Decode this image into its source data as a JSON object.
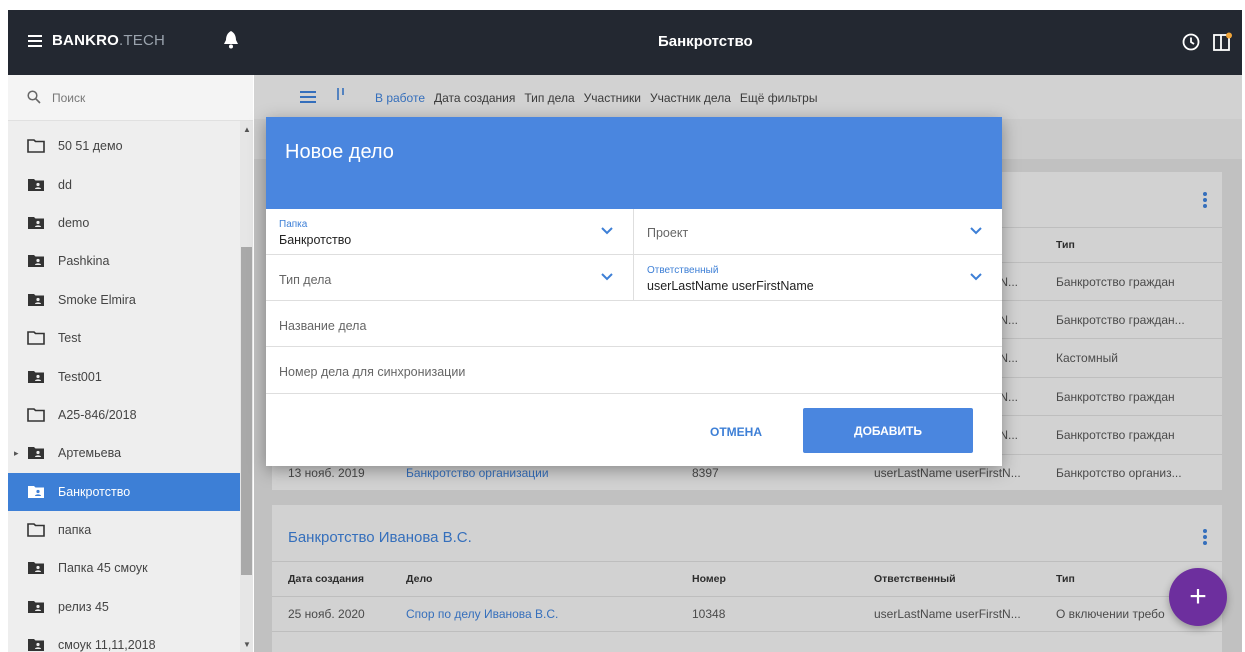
{
  "topbar": {
    "brand_main": "BANKRO",
    "brand_sub": ".TECH",
    "title": "Банкротство",
    "icons": [
      "menu-icon",
      "bell-icon",
      "clock-icon",
      "panel-icon"
    ]
  },
  "sidebar": {
    "search_placeholder": "Поиск",
    "folders": [
      {
        "label": "50 51 демо",
        "icon": "folder-outline-icon"
      },
      {
        "label": "dd",
        "icon": "folder-shared-icon"
      },
      {
        "label": "demo",
        "icon": "folder-shared-icon"
      },
      {
        "label": "Pashkina",
        "icon": "folder-shared-icon"
      },
      {
        "label": "Smoke Elmira",
        "icon": "folder-shared-icon"
      },
      {
        "label": "Test",
        "icon": "folder-outline-icon"
      },
      {
        "label": "Test001",
        "icon": "folder-shared-icon"
      },
      {
        "label": "А25-846/2018",
        "icon": "folder-outline-icon"
      },
      {
        "label": "Артемьева",
        "icon": "folder-shared-icon"
      },
      {
        "label": "Банкротство",
        "icon": "folder-shared-icon"
      },
      {
        "label": "папка",
        "icon": "folder-outline-icon"
      },
      {
        "label": "Папка 45 смоук",
        "icon": "folder-shared-icon"
      },
      {
        "label": "релиз 45",
        "icon": "folder-shared-icon"
      },
      {
        "label": "смоук 11,11,2018",
        "icon": "folder-shared-icon"
      }
    ]
  },
  "filters": {
    "items": [
      "В работе",
      "Дата создания",
      "Тип дела",
      "Участники",
      "Участник дела",
      "Ещё фильтры"
    ]
  },
  "card1": {
    "col_type": "Тип",
    "rows": [
      {
        "resp": "tN...",
        "type": "Банкротство граждан"
      },
      {
        "resp": "tN...",
        "type": "Банкротство граждан..."
      },
      {
        "resp": "tN...",
        "type": "Кастомный"
      },
      {
        "resp": "tN...",
        "type": "Банкротство граждан"
      },
      {
        "resp": "tN...",
        "type": "Банкротство граждан"
      }
    ],
    "last_row": {
      "date": "13 нояб. 2019",
      "case": "Банкротство организации",
      "number": "8397",
      "resp": "userLastName userFirstN...",
      "type": "Банкротство организ..."
    }
  },
  "card2": {
    "title": "Банкротство Иванова В.С.",
    "headers": {
      "date": "Дата создания",
      "case": "Дело",
      "number": "Номер",
      "resp": "Ответственный",
      "type": "Тип"
    },
    "rows": [
      {
        "date": "25 нояб. 2020",
        "case": "Спор по делу Иванова В.С.",
        "number": "10348",
        "resp": "userLastName userFirstN...",
        "type": "О включении требо"
      }
    ]
  },
  "dialog": {
    "title": "Новое дело",
    "folder_label": "Папка",
    "folder_value": "Банкротство",
    "project_placeholder": "Проект",
    "case_type_placeholder": "Тип дела",
    "responsible_label": "Ответственный",
    "responsible_value": "userLastName userFirstName",
    "case_name_placeholder": "Название дела",
    "sync_number_placeholder": "Номер дела для синхронизации",
    "cancel_label": "ОТМЕНА",
    "add_label": "ДОБАВИТЬ"
  },
  "fab": {
    "label": "+"
  },
  "colors": {
    "accent": "#3d7fd6",
    "dialog_header": "#4a86df",
    "topbar": "#232831",
    "fab": "#6d2f9e"
  }
}
